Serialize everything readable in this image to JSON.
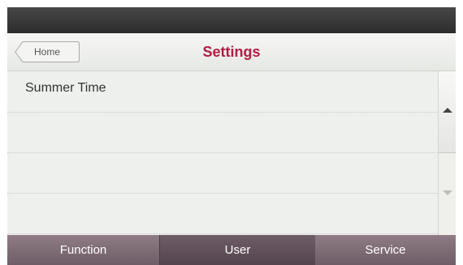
{
  "header": {
    "home_label": "Home",
    "title": "Settings"
  },
  "list": {
    "items": [
      {
        "label": "Summer Time"
      },
      {
        "label": ""
      },
      {
        "label": ""
      },
      {
        "label": ""
      }
    ]
  },
  "scrollbar": {
    "up_icon": "triangle-up",
    "down_icon": "triangle-down"
  },
  "tabs": [
    {
      "label": "Function"
    },
    {
      "label": "User"
    },
    {
      "label": "Service"
    }
  ],
  "colors": {
    "title": "#b31d42",
    "tab_bar": "#7a6872",
    "active_tab": "#5d4d56",
    "status_bar": "#3a3a3a"
  }
}
